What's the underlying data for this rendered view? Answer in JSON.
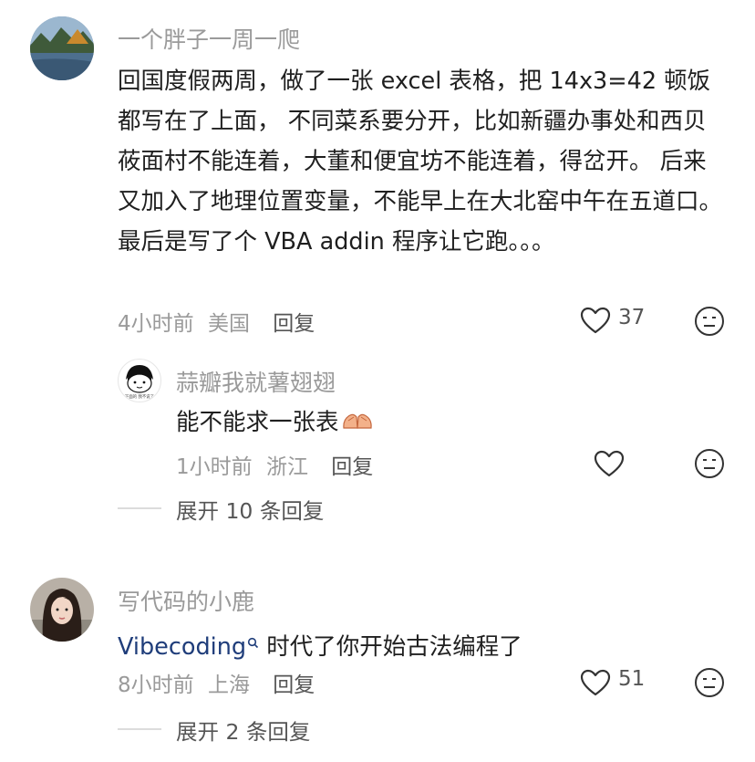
{
  "comments": [
    {
      "username": "一个胖子一周一爬",
      "text": "回国度假两周，做了一张 excel 表格，把 14x3=42 顿饭都写在了上面， 不同菜系要分开，比如新疆办事处和西贝莜面村不能连着，大董和便宜坊不能连着，得岔开。 后来又加入了地理位置变量，不能早上在大北窑中午在五道口。最后是写了个 VBA addin 程序让它跑。。。",
      "time": "4小时前",
      "location": "美国",
      "reply_label": "回复",
      "likes": "37",
      "reply": {
        "username": "蒜瓣我就薯翅翅",
        "avatar_caption": "下面的 我不说了",
        "text": "能不能求一张表",
        "time": "1小时前",
        "location": "浙江",
        "reply_label": "回复"
      },
      "expand_label": "展开 10 条回复"
    },
    {
      "username": "写代码的小鹿",
      "mention": "Vibecoding",
      "text": " 时代了你开始古法编程了",
      "time": "8小时前",
      "location": "上海",
      "reply_label": "回复",
      "likes": "51",
      "expand_label": "展开 2 条回复"
    }
  ]
}
